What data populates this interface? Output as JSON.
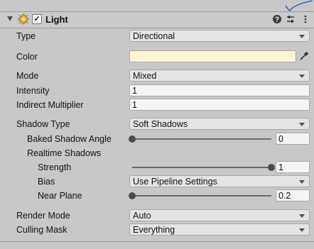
{
  "component": {
    "title": "Light",
    "enabled_mark": "✓",
    "icons": [
      "light-component-icon",
      "help-icon",
      "presets-icon",
      "kebab-menu-icon"
    ]
  },
  "colors": {
    "light_color": "#fdf4d5",
    "swatch_border": "#a8a8a8"
  },
  "rows": {
    "type": {
      "label": "Type",
      "value": "Directional"
    },
    "color": {
      "label": "Color"
    },
    "mode": {
      "label": "Mode",
      "value": "Mixed"
    },
    "intensity": {
      "label": "Intensity",
      "value": "1"
    },
    "indirect": {
      "label": "Indirect Multiplier",
      "value": "1"
    },
    "shadow_type": {
      "label": "Shadow Type",
      "value": "Soft Shadows"
    },
    "baked_angle": {
      "label": "Baked Shadow Angle",
      "value": "0",
      "slider_fraction": 0.0
    },
    "realtime": {
      "label": "Realtime Shadows"
    },
    "strength": {
      "label": "Strength",
      "value": "1",
      "slider_fraction": 1.0
    },
    "bias": {
      "label": "Bias",
      "value": "Use Pipeline Settings"
    },
    "near_plane": {
      "label": "Near Plane",
      "value": "0.2",
      "slider_fraction": 0.0
    },
    "render_mode": {
      "label": "Render Mode",
      "value": "Auto"
    },
    "culling_mask": {
      "label": "Culling Mask",
      "value": "Everything"
    }
  }
}
